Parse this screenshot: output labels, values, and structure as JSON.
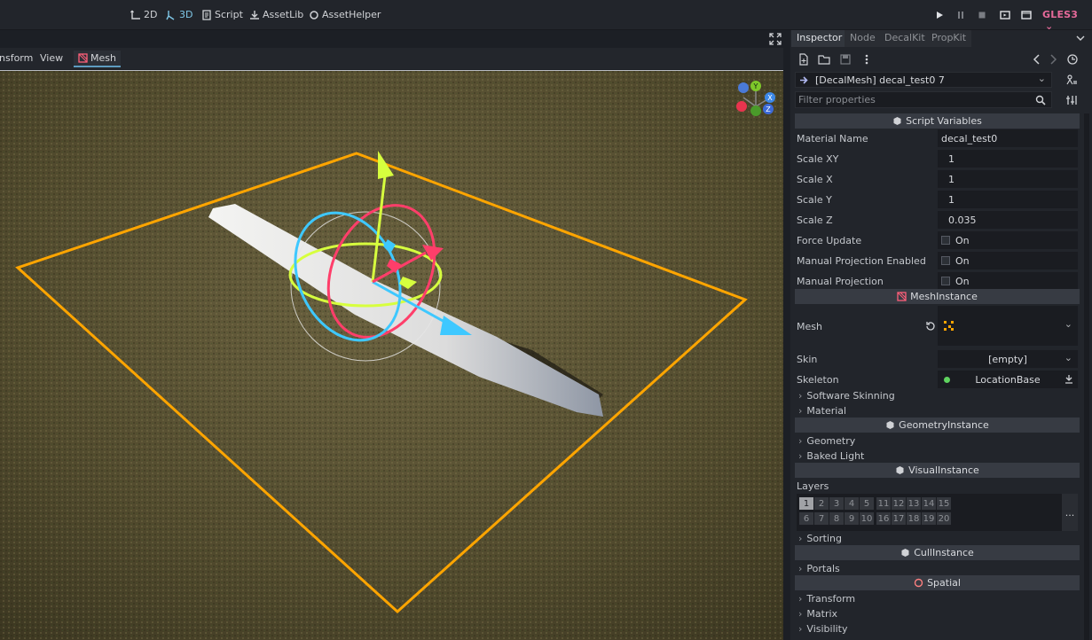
{
  "topbar": {
    "workspaces": [
      {
        "label": "2D",
        "active": false
      },
      {
        "label": "3D",
        "active": true
      },
      {
        "label": "Script",
        "active": false
      },
      {
        "label": "AssetLib",
        "active": false
      },
      {
        "label": "AssetHelper",
        "active": false
      }
    ],
    "renderer": "GLES3"
  },
  "viewport": {
    "menus": [
      "nsform",
      "View"
    ],
    "mesh_menu": "Mesh"
  },
  "inspector": {
    "tabs": [
      "Inspector",
      "Node",
      "DecalKit",
      "PropKit"
    ],
    "object": "[DecalMesh] decal_test0 7",
    "filter_placeholder": "Filter properties",
    "sections": {
      "script_variables": "Script Variables",
      "mesh_instance": "MeshInstance",
      "geometry_instance": "GeometryInstance",
      "visual_instance": "VisualInstance",
      "cull_instance": "CullInstance",
      "spatial": "Spatial"
    },
    "props": {
      "material_name": {
        "label": "Material Name",
        "value": "decal_test0"
      },
      "scale_xy": {
        "label": "Scale XY",
        "value": "1"
      },
      "scale_x": {
        "label": "Scale X",
        "value": "1"
      },
      "scale_y": {
        "label": "Scale Y",
        "value": "1"
      },
      "scale_z": {
        "label": "Scale Z",
        "value": "0.035"
      },
      "force_update": {
        "label": "Force Update",
        "value": "On"
      },
      "manual_projection_enabled": {
        "label": "Manual Projection Enabled",
        "value": "On"
      },
      "manual_projection": {
        "label": "Manual Projection",
        "value": "On"
      },
      "mesh": {
        "label": "Mesh"
      },
      "skin": {
        "label": "Skin",
        "value": "[empty]"
      },
      "skeleton": {
        "label": "Skeleton",
        "value": "LocationBase"
      },
      "layers": {
        "label": "Layers"
      }
    },
    "groups": {
      "software_skinning": "Software Skinning",
      "material": "Material",
      "geometry": "Geometry",
      "baked_light": "Baked Light",
      "sorting": "Sorting",
      "portals": "Portals",
      "transform": "Transform",
      "matrix": "Matrix",
      "visibility": "Visibility"
    },
    "layers_row1": [
      "1",
      "2",
      "3",
      "4",
      "5",
      "11",
      "12",
      "13",
      "14",
      "15"
    ],
    "layers_row2": [
      "6",
      "7",
      "8",
      "9",
      "10",
      "16",
      "17",
      "18",
      "19",
      "20"
    ],
    "layers_more": "..."
  },
  "colors": {
    "accent": "#7fc8e8",
    "renderer": "#e66a9a",
    "selection_box": "#ffa500",
    "gizmo_x": "#ff3e6a",
    "gizmo_y": "#d7ff3e",
    "gizmo_z": "#3ec8ff"
  }
}
